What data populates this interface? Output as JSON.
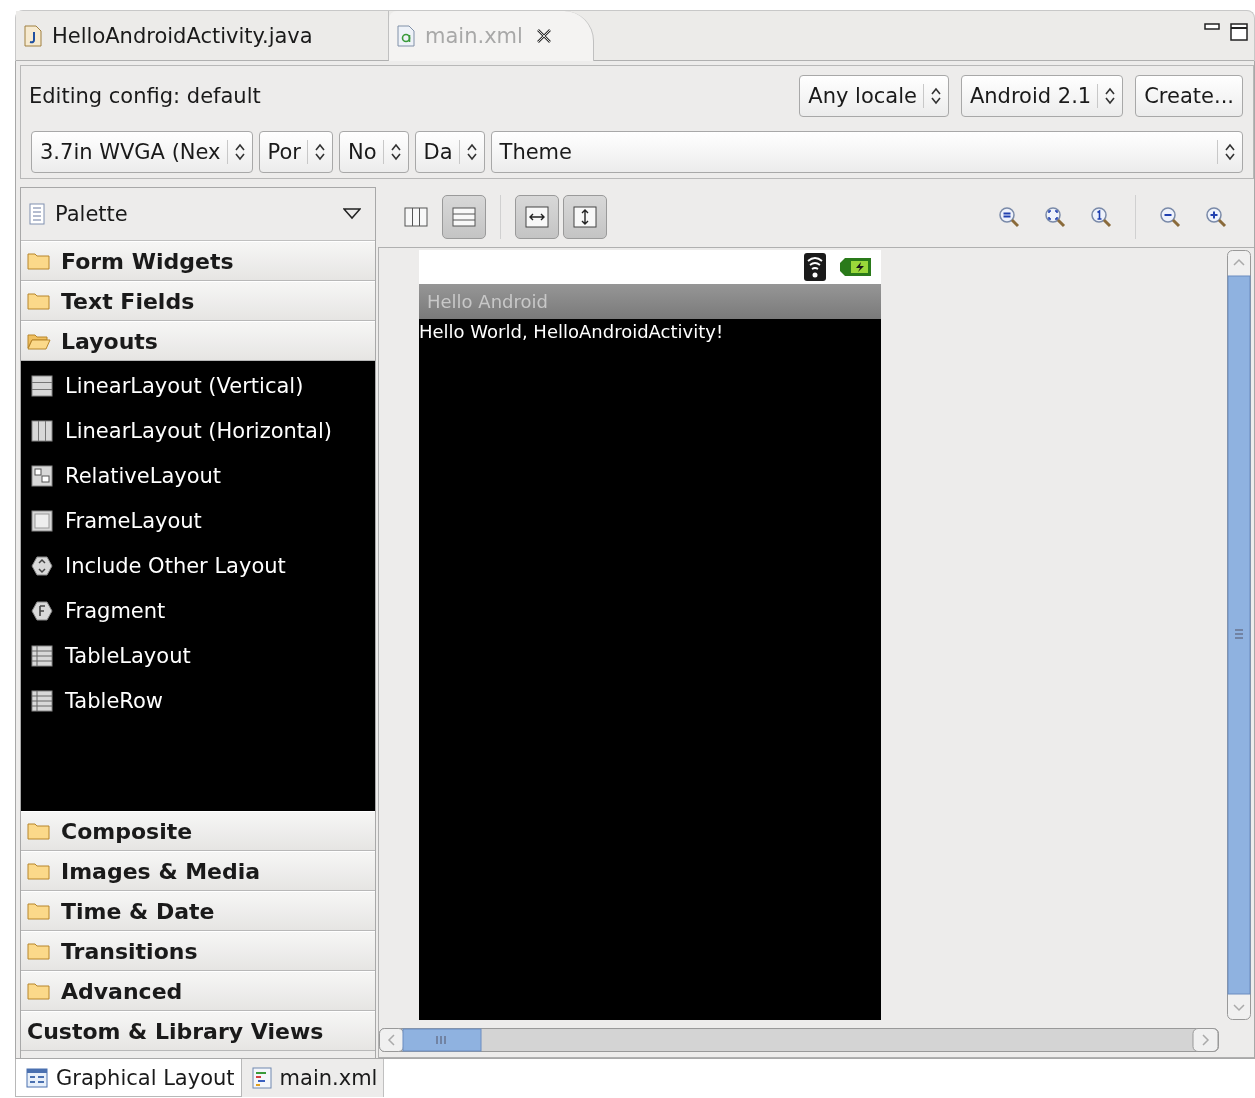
{
  "editor_tabs": [
    {
      "label": "HelloAndroidActivity.java",
      "kind": "java",
      "selected": false
    },
    {
      "label": "main.xml",
      "kind": "xml",
      "selected": true
    }
  ],
  "config": {
    "label": "Editing config: default",
    "row_1": [
      {
        "kind": "dropdown",
        "value": "Any locale"
      },
      {
        "kind": "dropdown",
        "value": "Android 2.1"
      },
      {
        "kind": "button",
        "value": "Create..."
      }
    ],
    "row_2": [
      {
        "kind": "dropdown",
        "value": "3.7in WVGA (Nex"
      },
      {
        "kind": "dropdown",
        "value": "Por"
      },
      {
        "kind": "dropdown",
        "value": "No"
      },
      {
        "kind": "dropdown",
        "value": "Da"
      },
      {
        "kind": "wide",
        "value": "Theme"
      }
    ]
  },
  "palette": {
    "title": "Palette",
    "categories": [
      {
        "label": "Form Widgets",
        "kind": "folder",
        "expanded": false
      },
      {
        "label": "Text Fields",
        "kind": "folder",
        "expanded": false
      },
      {
        "label": "Layouts",
        "kind": "folder",
        "expanded": true,
        "children": [
          {
            "label": "LinearLayout (Vertical)",
            "kind": "vertical"
          },
          {
            "label": "LinearLayout (Horizontal)",
            "kind": "horizontal"
          },
          {
            "label": "RelativeLayout",
            "kind": "relative"
          },
          {
            "label": "FrameLayout",
            "kind": "frame"
          },
          {
            "label": "Include Other Layout",
            "kind": "include"
          },
          {
            "label": "Fragment",
            "kind": "fragment"
          },
          {
            "label": "TableLayout",
            "kind": "table"
          },
          {
            "label": "TableRow",
            "kind": "table"
          }
        ]
      },
      {
        "label": "Composite",
        "kind": "folder",
        "expanded": false
      },
      {
        "label": "Images & Media",
        "kind": "folder",
        "expanded": false
      },
      {
        "label": "Time & Date",
        "kind": "folder",
        "expanded": false
      },
      {
        "label": "Transitions",
        "kind": "folder",
        "expanded": false
      },
      {
        "label": "Advanced",
        "kind": "folder",
        "expanded": false
      },
      {
        "label": "Custom & Library Views",
        "kind": "plain",
        "expanded": false
      }
    ]
  },
  "canvas_toolbar": {
    "layout_toggles": [
      {
        "kind": "columns",
        "selected": false
      },
      {
        "kind": "rows",
        "selected": true
      }
    ],
    "fit_buttons": [
      {
        "kind": "fit-width",
        "selected": true
      },
      {
        "kind": "fit-height",
        "selected": true
      }
    ]
  },
  "device": {
    "app_title": "Hello Android",
    "content_text": "Hello World, HelloAndroidActivity!"
  },
  "bottom_tabs": [
    {
      "label": "Graphical Layout",
      "kind": "graphical",
      "selected": true
    },
    {
      "label": "main.xml",
      "kind": "xml",
      "selected": false
    }
  ]
}
